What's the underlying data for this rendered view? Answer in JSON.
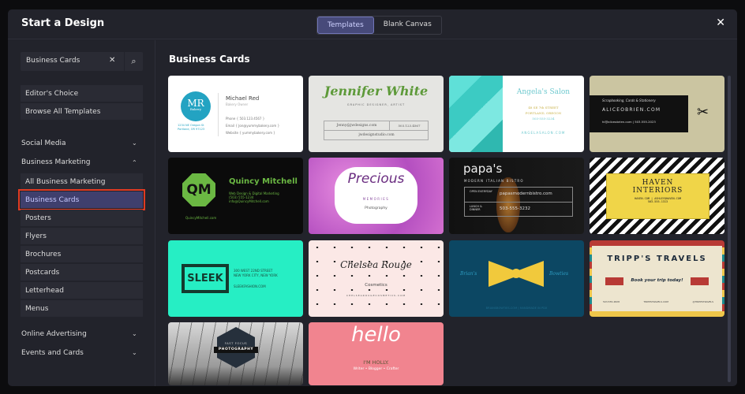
{
  "header": {
    "title": "Start a Design",
    "tabs": [
      {
        "label": "Templates",
        "active": true
      },
      {
        "label": "Blank Canvas",
        "active": false
      }
    ],
    "close_icon": "close-icon"
  },
  "sidebar": {
    "search": {
      "value": "Business Cards",
      "clear_icon": "x-icon",
      "search_icon": "magnifier-icon"
    },
    "top_items": [
      "Editor's Choice",
      "Browse All Templates"
    ],
    "sections": [
      {
        "label": "Social Media",
        "expanded": false
      },
      {
        "label": "Business Marketing",
        "expanded": true
      },
      {
        "label": "Online Advertising",
        "expanded": false
      },
      {
        "label": "Events and Cards",
        "expanded": false
      }
    ],
    "sub_items": [
      "All Business Marketing",
      "Business Cards",
      "Posters",
      "Flyers",
      "Brochures",
      "Postcards",
      "Letterhead",
      "Menus"
    ],
    "selected": "Business Cards",
    "highlight_color": "#e03a22"
  },
  "main": {
    "title": "Business Cards",
    "cards": {
      "mr": {
        "logo": "MR",
        "logo_sub": "Bakery",
        "name": "Michael Red",
        "role": "Bakery Owner",
        "phone_l": "Phone",
        "phone": "{ 503.123.4567 }",
        "email_l": "Email",
        "email": "{ Jon@yummybakery.com }",
        "web_l": "Website",
        "web": "{ yummybakery.com }",
        "addr1": "1234 NE Oregon St",
        "addr2": "Portland, OR 97123"
      },
      "jw": {
        "name": "Jennifer White",
        "role": "GRAPHIC DESIGNER, ARTIST",
        "email": "Jenny@jwdesigns.com",
        "phone": "503.123.4567",
        "web": "jwdesignstudio.com"
      },
      "angela": {
        "name": "Angela's Salon",
        "addr1": "48 SE 7th STREET",
        "addr2": "PORTLAND, OREGON",
        "phone": "503-555-3234",
        "web": "ANGELASALON.COM"
      },
      "alice": {
        "tag": "Scrapbooking, Cards & Stationery",
        "web": "ALICEOBRIEN.COM",
        "line": "hi@aliceobrien.com | 503.555.2023"
      },
      "qm": {
        "logo": "QM",
        "name": "Quincy Mitchell",
        "l1": "Web Design & Digital Marketing",
        "l2": "(503) 555-1234",
        "l3": "info@QuincyMitchell.com",
        "web": "QuincyMitchell.com"
      },
      "precious": {
        "name": "Precious",
        "sub": "MEMORIES",
        "sub2": "Photography"
      },
      "papa": {
        "name": "papa's",
        "sub": "MODERN ITALIAN BISTRO",
        "open": "OPEN EVERYDAY",
        "web": "papasmodernbistro.com",
        "lunch": "LUNCH & DINNER",
        "phone": "503-555-3232"
      },
      "haven": {
        "name1": "HAVEN",
        "name2": "INTERIORS",
        "line": "HAVEN.COM | ASHLEY@HAVEN.COM",
        "phone": "503-555-1313"
      },
      "sleek": {
        "logo": "SLEEK",
        "l1": "300 WEST 22ND STREET",
        "l2": "NEW YORK CITY, NEW YORK",
        "web": "SLEEKFASHION.COM"
      },
      "chelsea": {
        "name": "Chelsea Rouge",
        "sub": "Cosmetics",
        "web": "CHELSEAROUGECOSMETICS.COM"
      },
      "brian": {
        "left": "Brian's",
        "right": "Bowties",
        "line": "BRIANSBOWTIES.COM | HANDMADE IN PDX"
      },
      "tripp": {
        "name": "TRIPP'S TRAVELS",
        "tag": "Book your trip today!",
        "phone": "503.555.4828",
        "web": "TRIPPSTRAVELS.COM",
        "social": "@TRIPPSTRAVELS"
      },
      "photo": {
        "l1": "FAST FOCUS",
        "l2": "PHOTOGRAPHY"
      },
      "hello": {
        "big": "hello",
        "l1": "I'M HOLLY.",
        "l2": "Writer • Blogger • Crafter"
      }
    }
  }
}
